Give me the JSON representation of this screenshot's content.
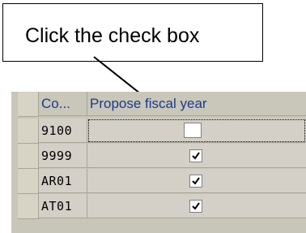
{
  "callout": {
    "text": "Click the check box"
  },
  "table": {
    "columns": [
      "Co...",
      "Propose fiscal year"
    ],
    "rows": [
      {
        "code": "9100",
        "propose_fiscal_year": false
      },
      {
        "code": "9999",
        "propose_fiscal_year": true
      },
      {
        "code": "AR01",
        "propose_fiscal_year": true
      },
      {
        "code": "AT01",
        "propose_fiscal_year": true
      }
    ]
  }
}
